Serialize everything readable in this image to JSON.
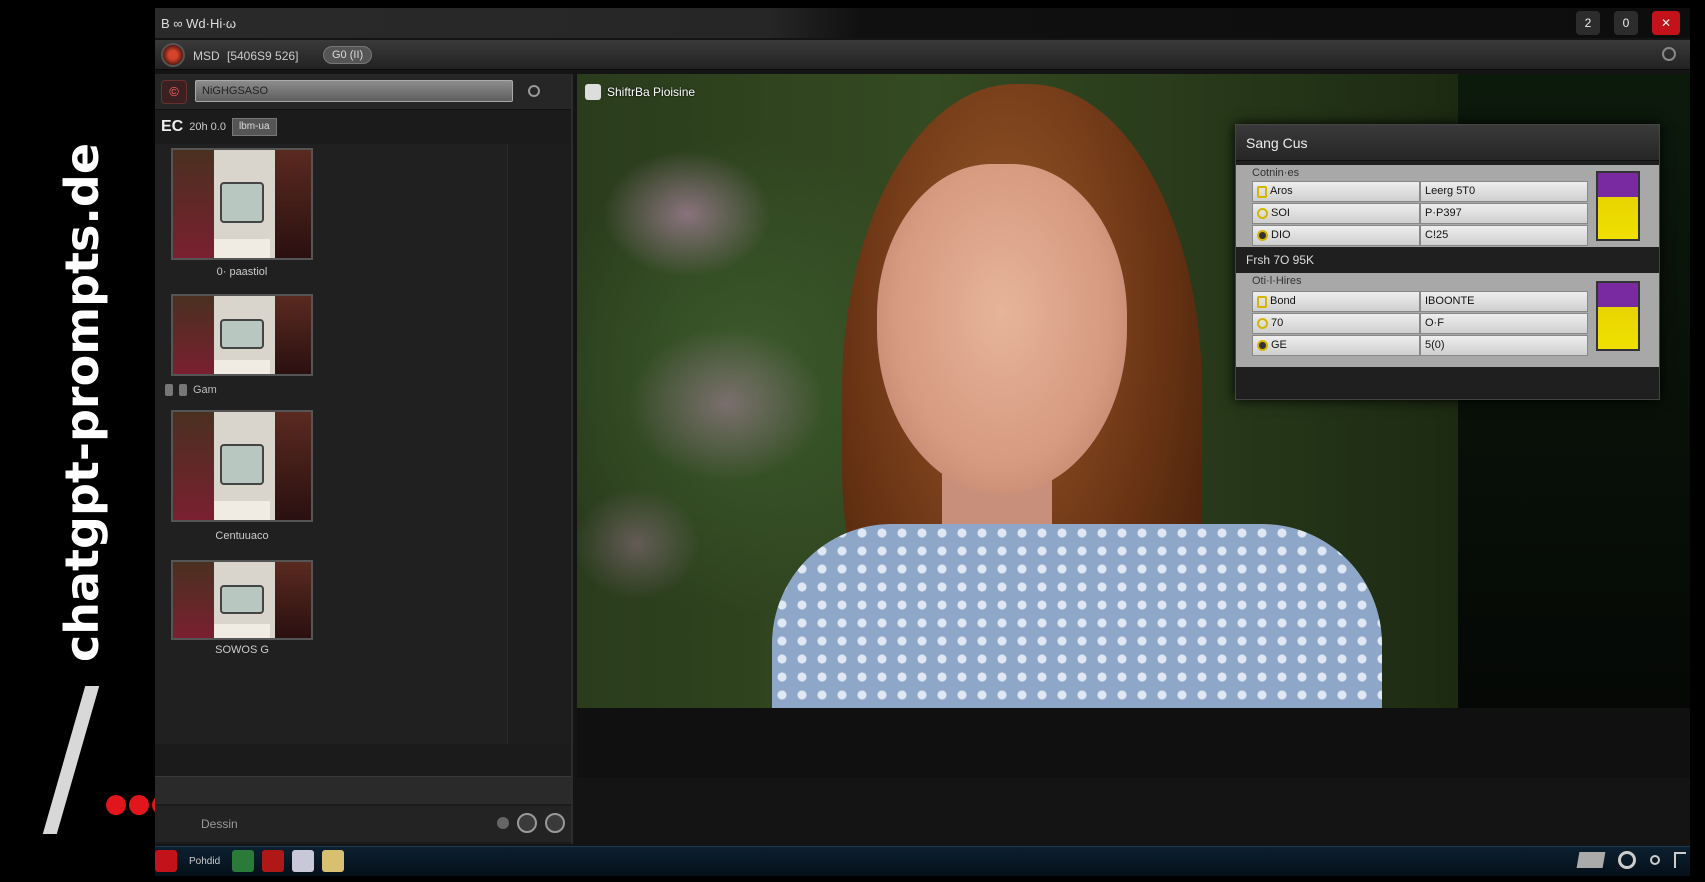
{
  "watermark": {
    "text": "chatgpt-prompts.de"
  },
  "window": {
    "title": "B ∞ Wd·Hi∙ω",
    "controls": [
      "2",
      "0",
      "✕"
    ]
  },
  "toolbar": {
    "label": "MSD",
    "field": "[5406S9 526]",
    "pill": "G0 (II)"
  },
  "left_panel": {
    "search": {
      "value": "NiGHGSASO"
    },
    "library": {
      "code": "EC",
      "count": "20h 0.0",
      "button": "lbm-ua"
    },
    "thumbnails": [
      {
        "caption": "0· paastiol"
      },
      {
        "tag": "Gam"
      },
      {
        "caption": "Centuuaco"
      },
      {
        "caption": "SOWOS G"
      }
    ],
    "status_text": "Dessin"
  },
  "viewer": {
    "title": "ShiftrBa Pioisine"
  },
  "settings": {
    "title": "Sang Cus",
    "group1": {
      "title": "Cotnin·es",
      "rows": [
        {
          "label": "Aros",
          "value": "Leerg 5T0"
        },
        {
          "label": "SOI",
          "value": "P·P397"
        },
        {
          "label": "DIO",
          "value": "C!25"
        }
      ]
    },
    "section_label": "Frsh 7O 95K",
    "group2": {
      "title": "Oti·l·Hires",
      "rows": [
        {
          "label": "Bond",
          "value": "IBOONTE"
        },
        {
          "label": "70",
          "value": "O·F"
        },
        {
          "label": "GE",
          "value": "5(0)"
        }
      ]
    },
    "accent_colors": {
      "purple": "#7a2aa0",
      "yellow": "#f0e000"
    }
  },
  "taskbar": {
    "label": "Pohdid"
  },
  "colors": {
    "close_red": "#c4121a",
    "watermark_red": "#e0161c"
  }
}
